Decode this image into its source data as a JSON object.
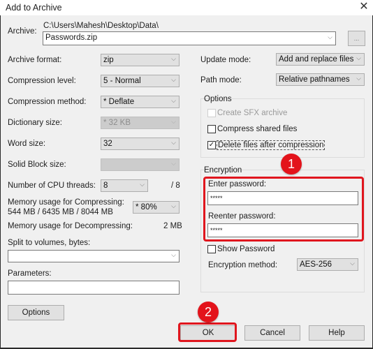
{
  "window": {
    "title": "Add to Archive",
    "close_icon": "✕"
  },
  "archive": {
    "label": "Archive:",
    "path": "C:\\Users\\Mahesh\\Desktop\\Data\\",
    "filename": "Passwords.zip",
    "browse_label": "..."
  },
  "left": {
    "archive_format": {
      "label": "Archive format:",
      "value": "zip"
    },
    "compression_level": {
      "label": "Compression level:",
      "value": "5 - Normal"
    },
    "compression_method": {
      "label": "Compression method:",
      "value": "* Deflate"
    },
    "dictionary_size": {
      "label": "Dictionary size:",
      "value": "* 32 KB"
    },
    "word_size": {
      "label": "Word size:",
      "value": "32"
    },
    "solid_block_size": {
      "label": "Solid Block size:",
      "value": ""
    },
    "cpu_threads": {
      "label": "Number of CPU threads:",
      "value": "8",
      "max": "/ 8"
    },
    "memory_compress": {
      "label": "Memory usage for Compressing:",
      "detail": "544 MB / 6435 MB / 8044 MB",
      "value": "* 80%"
    },
    "memory_decompress": {
      "label": "Memory usage for Decompressing:",
      "value": "2 MB"
    },
    "split": {
      "label": "Split to volumes, bytes:",
      "value": ""
    },
    "parameters": {
      "label": "Parameters:",
      "value": ""
    },
    "options_button": "Options"
  },
  "right": {
    "update_mode": {
      "label": "Update mode:",
      "value": "Add and replace files"
    },
    "path_mode": {
      "label": "Path mode:",
      "value": "Relative pathnames"
    },
    "options": {
      "title": "Options",
      "items": [
        {
          "label": "Create SFX archive",
          "checked": false,
          "disabled": true
        },
        {
          "label": "Compress shared files",
          "checked": false,
          "disabled": false
        },
        {
          "label": "Delete files after compression",
          "checked": true,
          "disabled": false
        }
      ]
    },
    "encryption": {
      "title": "Encryption",
      "enter_password_label": "Enter password:",
      "enter_password_value": "*****",
      "reenter_password_label": "Reenter password:",
      "reenter_password_value": "*****",
      "show_password_label": "Show Password",
      "method_label": "Encryption method:",
      "method_value": "AES-256"
    }
  },
  "buttons": {
    "ok": "OK",
    "cancel": "Cancel",
    "help": "Help"
  },
  "annotations": {
    "badge1": "1",
    "badge2": "2",
    "highlight_color": "#e0161e"
  },
  "icons": {
    "chevron": "⌵",
    "check": "✓"
  }
}
